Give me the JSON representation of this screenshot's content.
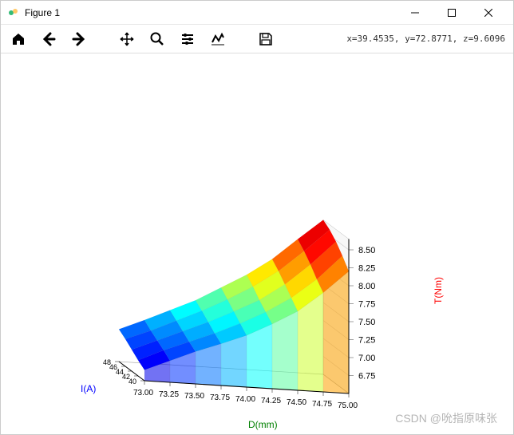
{
  "window": {
    "title": "Figure 1"
  },
  "toolbar": {
    "coord_text": "x=39.4535, y=72.8771, z=9.6096"
  },
  "watermark": "CSDN @吮指原味张",
  "chart_data": {
    "type": "surface",
    "xlabel": "D(mm)",
    "ylabel": "I(A)",
    "zlabel": "T(Nm)",
    "x_ticks": [
      "73.00",
      "73.25",
      "73.50",
      "73.75",
      "74.00",
      "74.25",
      "74.50",
      "74.75",
      "75.00"
    ],
    "y_ticks": [
      "40",
      "42",
      "44",
      "46",
      "48"
    ],
    "z_ticks": [
      "6.75",
      "7.00",
      "7.25",
      "7.50",
      "7.75",
      "8.00",
      "8.25",
      "8.50"
    ],
    "x": [
      73.0,
      73.25,
      73.5,
      73.75,
      74.0,
      74.25,
      74.5,
      74.75,
      75.0
    ],
    "y": [
      40,
      42,
      44,
      46,
      48
    ],
    "z_grid": [
      [
        6.65,
        6.8,
        6.95,
        7.08,
        7.22,
        7.4,
        7.6,
        7.88,
        8.2
      ],
      [
        6.72,
        6.88,
        7.02,
        7.16,
        7.32,
        7.5,
        7.72,
        8.0,
        8.35
      ],
      [
        6.8,
        6.95,
        7.1,
        7.25,
        7.42,
        7.6,
        7.84,
        8.14,
        8.48
      ],
      [
        6.88,
        7.02,
        7.18,
        7.34,
        7.52,
        7.72,
        7.96,
        8.26,
        8.58
      ],
      [
        6.95,
        7.1,
        7.26,
        7.42,
        7.62,
        7.82,
        8.06,
        8.36,
        8.65
      ]
    ],
    "xlim": [
      73.0,
      75.0
    ],
    "ylim": [
      40,
      48
    ],
    "zlim": [
      6.5,
      8.65
    ],
    "colormap": "jet"
  }
}
